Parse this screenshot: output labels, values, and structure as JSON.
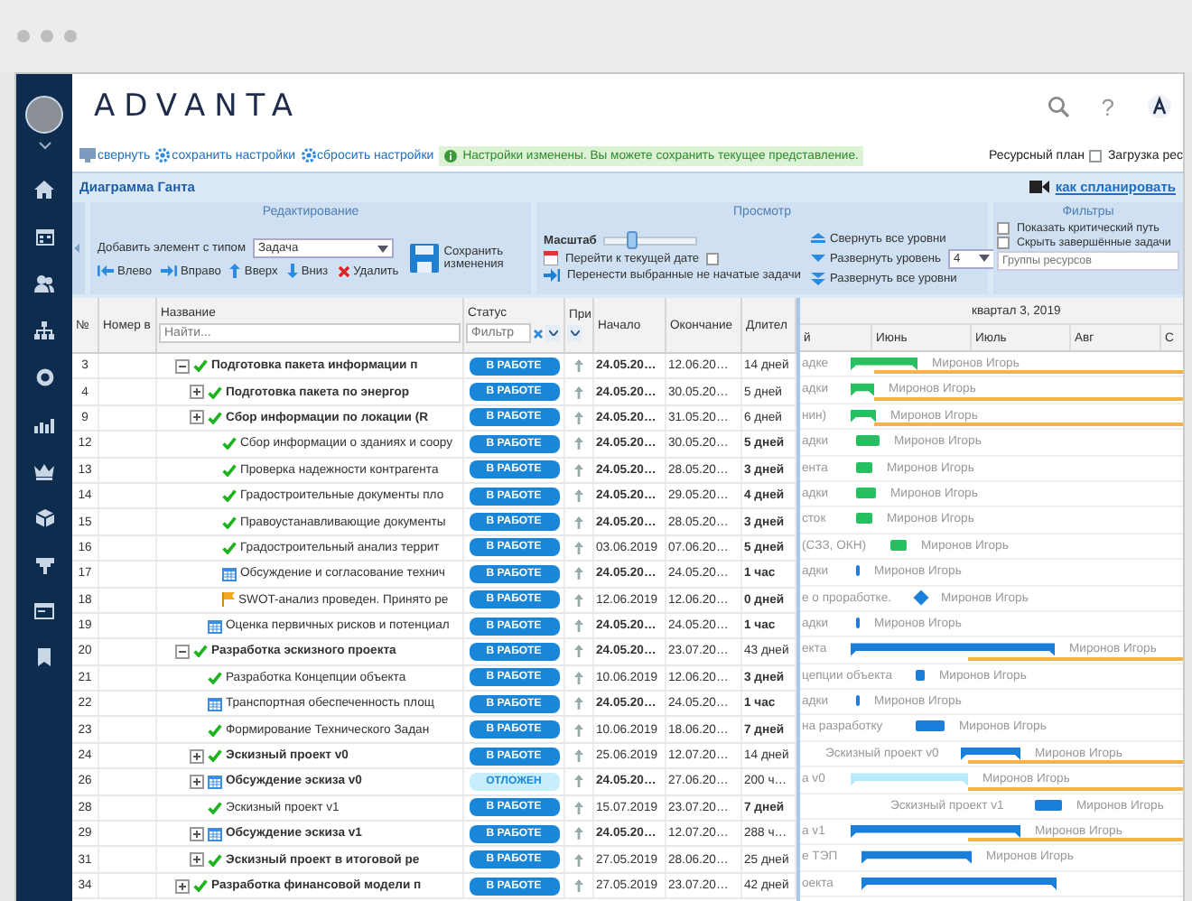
{
  "logo": "ADVANTA",
  "top_icons": {
    "help": "?"
  },
  "toolbar_links": [
    {
      "label": "свернуть",
      "kind": "monitor"
    },
    {
      "label": "сохранить настройки",
      "kind": "gear"
    },
    {
      "label": "сбросить настройки",
      "kind": "gear"
    }
  ],
  "notice": "Настройки изменены. Вы можете сохранить текущее представление.",
  "resource_plan": {
    "label": "Ресурсный план",
    "checked": false
  },
  "load_label": "Загрузка рес",
  "page_title": "Диаграмма Ганта",
  "help_link": "как спланировать",
  "ribbon": {
    "edit": {
      "title": "Редактирование",
      "add_label": "Добавить элемент с типом",
      "add_type": "Задача",
      "actions": [
        {
          "label": "Влево",
          "kind": "left"
        },
        {
          "label": "Вправо",
          "kind": "right"
        },
        {
          "label": "Вверх",
          "kind": "up"
        },
        {
          "label": "Вниз",
          "kind": "down"
        },
        {
          "label": "Удалить",
          "kind": "delete"
        }
      ],
      "save": "Сохранить изменения"
    },
    "view": {
      "title": "Просмотр",
      "scale_label": "Масштаб",
      "scale": {
        "level": 0.3
      },
      "today_label": "Перейти к текущей дате",
      "today_checked": false,
      "move_label": "Перенести выбранные не начатые задачи",
      "collapse_all": "Свернуть все уровни",
      "expand_level": "Развернуть уровень",
      "level_value": "4",
      "expand_all": "Развернуть все уровни"
    },
    "filters": {
      "title": "Фильтры",
      "options": [
        {
          "label": "Показать критический путь",
          "checked": false
        },
        {
          "label": "Скрыть завершённые задачи",
          "checked": false
        }
      ],
      "groups_placeholder": "Группы ресурсов"
    }
  },
  "table": {
    "columns": [
      "№",
      "Номер в",
      "Название",
      "Статус",
      "При",
      "Начало",
      "Окончание",
      "Длител"
    ],
    "name_placeholder": "Найти...",
    "status_placeholder": "Фильтр",
    "rows": [
      {
        "number": "3",
        "name": "Подготовка пакета информации п",
        "expanded": true,
        "kind": "check",
        "status": {
          "text": "В РАБОТЕ",
          "kind": "in_progress"
        },
        "start": "24.05.20…",
        "start_bold": true,
        "end": "12.06.20…",
        "duration": "14 дней",
        "duration_bold": false,
        "bar": {
          "spill": "адке",
          "resource": "Миронов Игорь",
          "kind": "summary",
          "color": "#27c060"
        },
        "children": [
          {
            "number": "4",
            "name": "Подготовка пакета по энергор",
            "expanded": false,
            "kind": "check",
            "status": {
              "text": "В РАБОТЕ",
              "kind": "in_progress"
            },
            "start": "24.05.20…",
            "start_bold": true,
            "end": "30.05.20…",
            "duration": "5 дней",
            "duration_bold": false,
            "bar": {
              "spill": "адки",
              "resource": "Миронов Игорь",
              "kind": "summary",
              "color": "#27c060"
            }
          },
          {
            "number": "9",
            "name": "Сбор информации по локации (R",
            "expanded": false,
            "kind": "check",
            "status": {
              "text": "В РАБОТЕ",
              "kind": "in_progress"
            },
            "start": "24.05.20…",
            "start_bold": true,
            "end": "31.05.20…",
            "duration": "6 дней",
            "duration_bold": false,
            "bar": {
              "spill": "нин)",
              "resource": "Миронов Игорь",
              "kind": "summary",
              "color": "#27c060"
            },
            "children": [
              {
                "number": "12",
                "name": "Сбор информации о зданиях и соору",
                "kind": "check",
                "status": {
                  "text": "В РАБОТЕ",
                  "kind": "in_progress"
                },
                "start": "24.05.20…",
                "start_bold": true,
                "end": "30.05.20…",
                "duration": "5 дней",
                "duration_bold": true,
                "bar": {
                  "spill": "адки",
                  "resource": "Миронов Игорь",
                  "kind": "task",
                  "color": "#27c060"
                }
              },
              {
                "number": "13",
                "name": "Проверка надежности контрагента",
                "kind": "check",
                "status": {
                  "text": "В РАБОТЕ",
                  "kind": "in_progress"
                },
                "start": "24.05.20…",
                "start_bold": true,
                "end": "28.05.20…",
                "duration": "3 дней",
                "duration_bold": true,
                "bar": {
                  "spill": "ента",
                  "resource": "Миронов Игорь",
                  "kind": "task",
                  "color": "#27c060"
                }
              },
              {
                "number": "14",
                "name": "Градостроительные документы пло",
                "kind": "check",
                "status": {
                  "text": "В РАБОТЕ",
                  "kind": "in_progress"
                },
                "start": "24.05.20…",
                "start_bold": true,
                "end": "29.05.20…",
                "duration": "4 дней",
                "duration_bold": true,
                "bar": {
                  "spill": "адки",
                  "resource": "Миронов Игорь",
                  "kind": "task",
                  "color": "#27c060"
                }
              },
              {
                "number": "15",
                "name": "Правоустанавливающие документы",
                "kind": "check",
                "status": {
                  "text": "В РАБОТЕ",
                  "kind": "in_progress"
                },
                "start": "24.05.20…",
                "start_bold": true,
                "end": "28.05.20…",
                "duration": "3 дней",
                "duration_bold": true,
                "bar": {
                  "spill": "сток",
                  "resource": "Миронов Игорь",
                  "kind": "task",
                  "color": "#27c060"
                }
              },
              {
                "number": "16",
                "name": "Градостроительный анализ террит",
                "kind": "check",
                "status": {
                  "text": "В РАБОТЕ",
                  "kind": "in_progress"
                },
                "start": "03.06.2019",
                "start_bold": false,
                "end": "07.06.20…",
                "duration": "5 дней",
                "duration_bold": true,
                "bar": {
                  "spill": "(СЗЗ, ОКН)",
                  "resource": "Миронов Игорь",
                  "kind": "task",
                  "color": "#27c060"
                }
              },
              {
                "number": "17",
                "name": "Обсуждение и согласование технич",
                "kind": "calendar",
                "status": {
                  "text": "В РАБОТЕ",
                  "kind": "in_progress"
                },
                "start": "24.05.20…",
                "start_bold": true,
                "end": "24.05.20…",
                "duration": "1 час",
                "duration_bold": true,
                "bar": {
                  "spill": "адки",
                  "resource": "Миронов Игорь",
                  "kind": "task",
                  "color": "#1a7fd8"
                }
              },
              {
                "number": "18",
                "name": "SWOT-анализ проведен. Принято ре",
                "kind": "flag",
                "status": {
                  "text": "В РАБОТЕ",
                  "kind": "in_progress"
                },
                "start": "12.06.2019",
                "start_bold": false,
                "end": "12.06.20…",
                "duration": "0 дней",
                "duration_bold": true,
                "bar": {
                  "spill": "е о проработке.",
                  "resource": "Миронов Игорь",
                  "kind": "milestone",
                  "color": "#1a7fd8"
                }
              }
            ]
          },
          {
            "number": "19",
            "name": "Оценка первичных рисков и потенциал",
            "kind": "calendar",
            "status": {
              "text": "В РАБОТЕ",
              "kind": "in_progress"
            },
            "start": "24.05.20…",
            "start_bold": true,
            "end": "24.05.20…",
            "duration": "1 час",
            "duration_bold": true,
            "bar": {
              "spill": "адки",
              "resource": "Миронов Игорь",
              "kind": "task",
              "color": "#1a7fd8"
            }
          }
        ]
      },
      {
        "number": "20",
        "name": "Разработка эскизного проекта",
        "expanded": true,
        "kind": "check",
        "status": {
          "text": "В РАБОТЕ",
          "kind": "in_progress"
        },
        "start": "24.05.20…",
        "start_bold": true,
        "end": "23.07.20…",
        "duration": "43 дней",
        "duration_bold": false,
        "bar": {
          "spill": "екта",
          "resource": "Миронов Игорь",
          "kind": "summary",
          "color": "#1a7fd8"
        },
        "children": [
          {
            "number": "21",
            "name": "Разработка Концепции объекта",
            "kind": "check",
            "status": {
              "text": "В РАБОТЕ",
              "kind": "in_progress"
            },
            "start": "10.06.2019",
            "start_bold": false,
            "end": "12.06.20…",
            "duration": "3 дней",
            "duration_bold": true,
            "bar": {
              "spill": "цепции объекта",
              "resource": "Миронов Игорь",
              "kind": "task",
              "color": "#1a7fd8"
            }
          },
          {
            "number": "22",
            "name": "Транспортная обеспеченность площ",
            "kind": "calendar",
            "status": {
              "text": "В РАБОТЕ",
              "kind": "in_progress"
            },
            "start": "24.05.20…",
            "start_bold": true,
            "end": "24.05.20…",
            "duration": "1 час",
            "duration_bold": true,
            "bar": {
              "spill": "адки",
              "resource": "Миронов Игорь",
              "kind": "task",
              "color": "#1a7fd8"
            }
          },
          {
            "number": "23",
            "name": "Формирование Технического Задан",
            "kind": "check",
            "status": {
              "text": "В РАБОТЕ",
              "kind": "in_progress"
            },
            "start": "10.06.2019",
            "start_bold": false,
            "end": "18.06.20…",
            "duration": "7 дней",
            "duration_bold": true,
            "bar": {
              "spill": "на разработку",
              "resource": "Миронов Игорь",
              "kind": "task",
              "color": "#1a7fd8"
            }
          },
          {
            "number": "24",
            "name": "Эскизный проект v0",
            "expanded": false,
            "kind": "check",
            "status": {
              "text": "В РАБОТЕ",
              "kind": "in_progress"
            },
            "start": "25.06.2019",
            "start_bold": false,
            "end": "12.07.20…",
            "duration": "14 дней",
            "duration_bold": false,
            "bar": {
              "spill": "Эскизный проект v0",
              "resource": "Миронов Игорь",
              "kind": "summary",
              "color": "#1a7fd8"
            }
          },
          {
            "number": "26",
            "name": "Обсуждение эскиза v0",
            "expanded": false,
            "kind": "calendar",
            "status": {
              "text": "ОТЛОЖЕН",
              "kind": "postponed"
            },
            "start": "24.05.20…",
            "start_bold": true,
            "end": "27.06.20…",
            "duration": "200 ч…",
            "duration_bold": false,
            "bar": {
              "spill": "а v0",
              "resource": "Миронов Игорь",
              "kind": "summary",
              "color": "#b7ebfa"
            }
          },
          {
            "number": "28",
            "name": "Эскизный проект v1",
            "kind": "check",
            "status": {
              "text": "В РАБОТЕ",
              "kind": "in_progress"
            },
            "start": "15.07.2019",
            "start_bold": false,
            "end": "23.07.20…",
            "duration": "7 дней",
            "duration_bold": true,
            "bar": {
              "spill": "Эскизный проект v1",
              "resource": "Миронов Игорь",
              "kind": "task",
              "color": "#1a7fd8"
            }
          },
          {
            "number": "29",
            "name": "Обсуждение эскиза v1",
            "expanded": false,
            "kind": "calendar",
            "status": {
              "text": "В РАБОТЕ",
              "kind": "in_progress"
            },
            "start": "24.05.20…",
            "start_bold": true,
            "end": "12.07.20…",
            "duration": "288 ч…",
            "duration_bold": false,
            "bar": {
              "spill": "а v1",
              "resource": "Миронов Игорь",
              "kind": "summary",
              "color": "#1a7fd8"
            }
          },
          {
            "number": "31",
            "name": "Эскизный проект в итоговой ре",
            "expanded": false,
            "kind": "check",
            "status": {
              "text": "В РАБОТЕ",
              "kind": "in_progress"
            },
            "start": "27.05.2019",
            "start_bold": false,
            "end": "28.06.20…",
            "duration": "25 дней",
            "duration_bold": false,
            "bar": {
              "spill": "е ТЭП",
              "resource": "Миронов Игорь",
              "kind": "summary",
              "color": "#1a7fd8"
            }
          }
        ]
      },
      {
        "number": "34",
        "name": "Разработка финансовой модели п",
        "expanded": false,
        "kind": "check",
        "status": {
          "text": "В РАБОТЕ",
          "kind": "in_progress"
        },
        "start": "27.05.2019",
        "start_bold": false,
        "end": "23.07.20…",
        "duration": "42 дней",
        "duration_bold": false,
        "bar": {
          "spill": "оекта",
          "kind": "summary",
          "color": "#1a7fd8"
        }
      }
    ]
  },
  "gantt": {
    "period": "квартал 3, 2019",
    "months": [
      "й",
      "Июнь",
      "Июль",
      "Авг",
      "С"
    ]
  }
}
